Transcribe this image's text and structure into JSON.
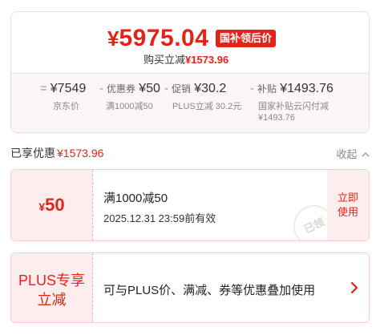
{
  "price_summary": {
    "currency": "¥",
    "final_price": "5975.04",
    "price_tag": "国补领后价",
    "reduce_label": "购买立减",
    "reduce_amount": "¥1573.96",
    "formula": [
      {
        "op": "=",
        "tag": "",
        "value": "¥7549",
        "sub": "京东价"
      },
      {
        "op": "-",
        "tag": "优惠券",
        "value": "¥50",
        "sub": "满1000减50"
      },
      {
        "op": "-",
        "tag": "促销",
        "value": "¥30.2",
        "sub": "PLUS立减 30.2元"
      },
      {
        "op": "-",
        "tag": "补贴",
        "value": "¥1493.76",
        "sub": "国家补贴云闪付减",
        "sub2": "¥1493.76"
      }
    ]
  },
  "discount_section": {
    "label": "已享优惠",
    "amount": "¥1573.96",
    "collapse": "收起"
  },
  "coupon": {
    "currency": "¥",
    "value": "50",
    "title": "满1000减50",
    "date": "2025.12.31 23:59前有效",
    "action_line1": "立即",
    "action_line2": "使用",
    "stamp": "已领"
  },
  "plus_offer": {
    "line1": "PLUS专享",
    "line2": "立减",
    "text": "可与PLUS价、满减、券等优惠叠加使用"
  },
  "colors": {
    "accent": "#e2231a",
    "coupon_bg": "#fdeded",
    "card_border": "#f5cfcf"
  }
}
